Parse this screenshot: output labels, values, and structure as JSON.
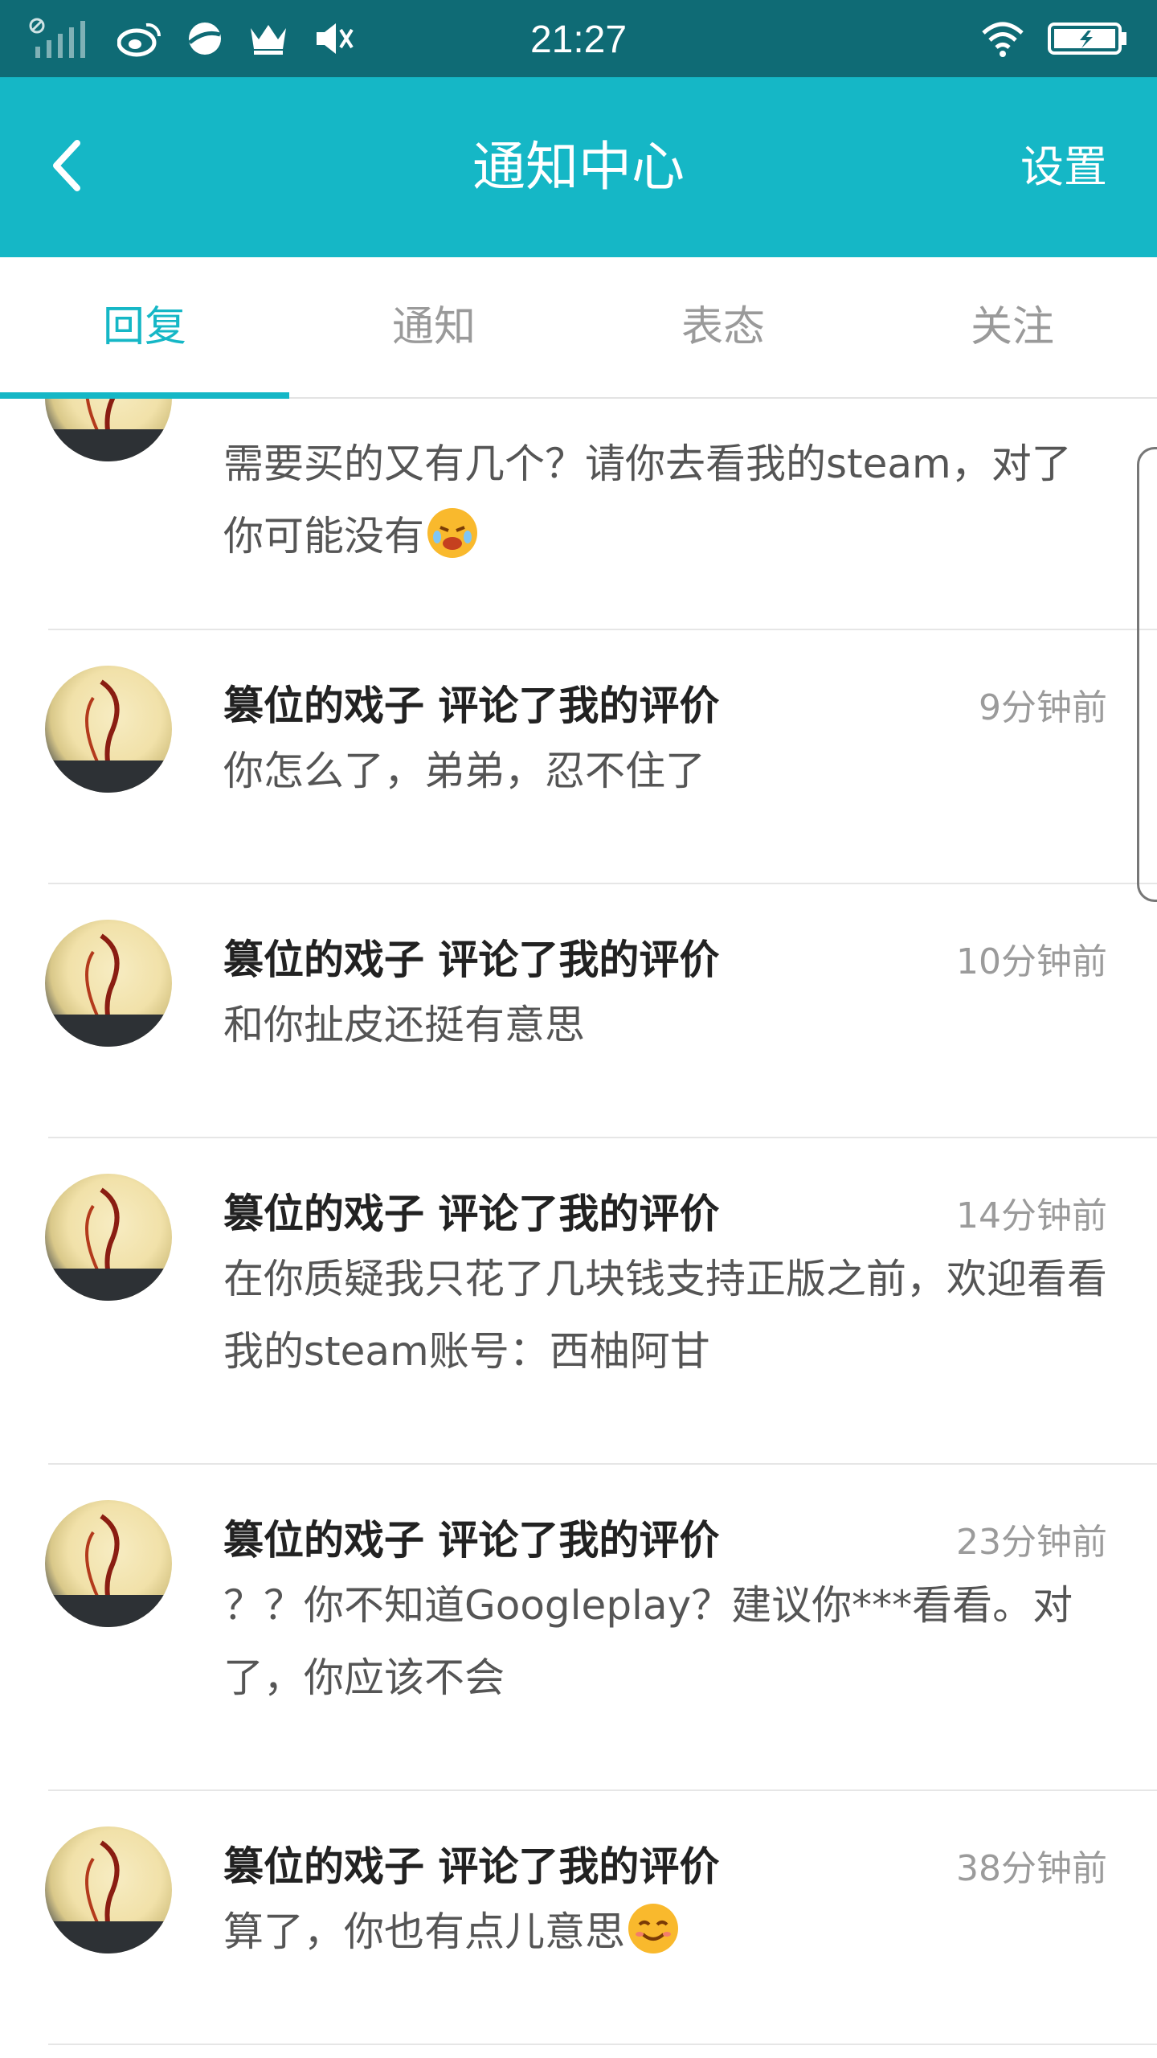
{
  "status_bar": {
    "time": "21:27",
    "left_icons": [
      "no-sim-signal-icon",
      "weibo-icon",
      "planet-app-icon",
      "crown-icon",
      "mute-icon"
    ],
    "right_icons": [
      "wifi-icon",
      "battery-charging-icon"
    ]
  },
  "header": {
    "title": "通知中心",
    "settings_label": "设置",
    "back_icon": "chevron-left-icon",
    "color": "#15b7c6"
  },
  "tabs": [
    {
      "label": "回复",
      "active": true
    },
    {
      "label": "通知",
      "active": false
    },
    {
      "label": "表态",
      "active": false
    },
    {
      "label": "关注",
      "active": false
    }
  ],
  "items": [
    {
      "who": "",
      "time": "",
      "content": "需要买的又有几个？请你去看我的steam，对了你可能没有",
      "emoji": "crying-face-emoji"
    },
    {
      "who": "篡位的戏子 评论了我的评价",
      "time": "9分钟前",
      "content": "你怎么了，弟弟，忍不住了"
    },
    {
      "who": "篡位的戏子 评论了我的评价",
      "time": "10分钟前",
      "content": "和你扯皮还挺有意思"
    },
    {
      "who": "篡位的戏子 评论了我的评价",
      "time": "14分钟前",
      "content": "在你质疑我只花了几块钱支持正版之前，欢迎看看我的steam账号：西柚阿甘"
    },
    {
      "who": "篡位的戏子 评论了我的评价",
      "time": "23分钟前",
      "content": "？？你不知道Googleplay？建议你***看看。对了，你应该不会"
    },
    {
      "who": "篡位的戏子 评论了我的评价",
      "time": "38分钟前",
      "content": "算了，你也有点儿意思",
      "emoji": "smiling-face-emoji"
    }
  ]
}
